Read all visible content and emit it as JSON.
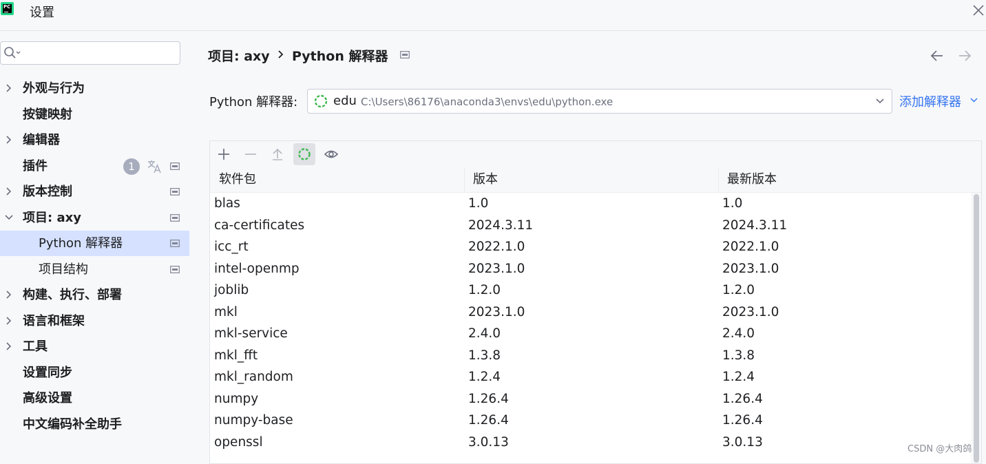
{
  "window": {
    "title": "设置",
    "app_icon_text": "PC"
  },
  "sidebar": {
    "search_placeholder": "",
    "items": [
      {
        "label": "外观与行为",
        "expandable": true,
        "expanded": false,
        "child": false,
        "has_settings_icon": false
      },
      {
        "label": "按键映射",
        "expandable": false,
        "child": false,
        "has_settings_icon": false
      },
      {
        "label": "编辑器",
        "expandable": true,
        "expanded": false,
        "child": false,
        "has_settings_icon": false
      },
      {
        "label": "插件",
        "expandable": false,
        "child": false,
        "badge": "1",
        "has_translate_icon": true,
        "has_settings_icon": true
      },
      {
        "label": "版本控制",
        "expandable": true,
        "expanded": false,
        "child": false,
        "has_settings_icon": true
      },
      {
        "label": "项目: axy",
        "expandable": true,
        "expanded": true,
        "child": false,
        "has_settings_icon": true
      },
      {
        "label": "Python 解释器",
        "expandable": false,
        "child": true,
        "selected": true,
        "has_settings_icon": true
      },
      {
        "label": "项目结构",
        "expandable": false,
        "child": true,
        "has_settings_icon": true
      },
      {
        "label": "构建、执行、部署",
        "expandable": true,
        "expanded": false,
        "child": false,
        "has_settings_icon": false
      },
      {
        "label": "语言和框架",
        "expandable": true,
        "expanded": false,
        "child": false,
        "has_settings_icon": false
      },
      {
        "label": "工具",
        "expandable": true,
        "expanded": false,
        "child": false,
        "has_settings_icon": false
      },
      {
        "label": "设置同步",
        "expandable": false,
        "child": false,
        "has_settings_icon": false
      },
      {
        "label": "高级设置",
        "expandable": false,
        "child": false,
        "has_settings_icon": false
      },
      {
        "label": "中文编码补全助手",
        "expandable": false,
        "child": false,
        "has_settings_icon": false
      }
    ]
  },
  "main": {
    "breadcrumb": {
      "parent": "项目: axy",
      "current": "Python 解释器"
    },
    "interpreter": {
      "label": "Python 解释器:",
      "env_name": "edu",
      "env_path": "C:\\Users\\86176\\anaconda3\\envs\\edu\\python.exe",
      "add_label": "添加解释器"
    },
    "packages": {
      "columns": [
        "软件包",
        "版本",
        "最新版本"
      ],
      "rows": [
        [
          "blas",
          "1.0",
          "1.0"
        ],
        [
          "ca-certificates",
          "2024.3.11",
          "2024.3.11"
        ],
        [
          "icc_rt",
          "2022.1.0",
          "2022.1.0"
        ],
        [
          "intel-openmp",
          "2023.1.0",
          "2023.1.0"
        ],
        [
          "joblib",
          "1.2.0",
          "1.2.0"
        ],
        [
          "mkl",
          "2023.1.0",
          "2023.1.0"
        ],
        [
          "mkl-service",
          "2.4.0",
          "2.4.0"
        ],
        [
          "mkl_fft",
          "1.3.8",
          "1.3.8"
        ],
        [
          "mkl_random",
          "1.2.4",
          "1.2.4"
        ],
        [
          "numpy",
          "1.26.4",
          "1.26.4"
        ],
        [
          "numpy-base",
          "1.26.4",
          "1.26.4"
        ],
        [
          "openssl",
          "3.0.13",
          "3.0.13"
        ]
      ]
    }
  },
  "colors": {
    "accent": "#3574f0",
    "selection": "#d5e1ff",
    "spinner": "#3fb950"
  },
  "watermark": "CSDN @大肉鸽"
}
